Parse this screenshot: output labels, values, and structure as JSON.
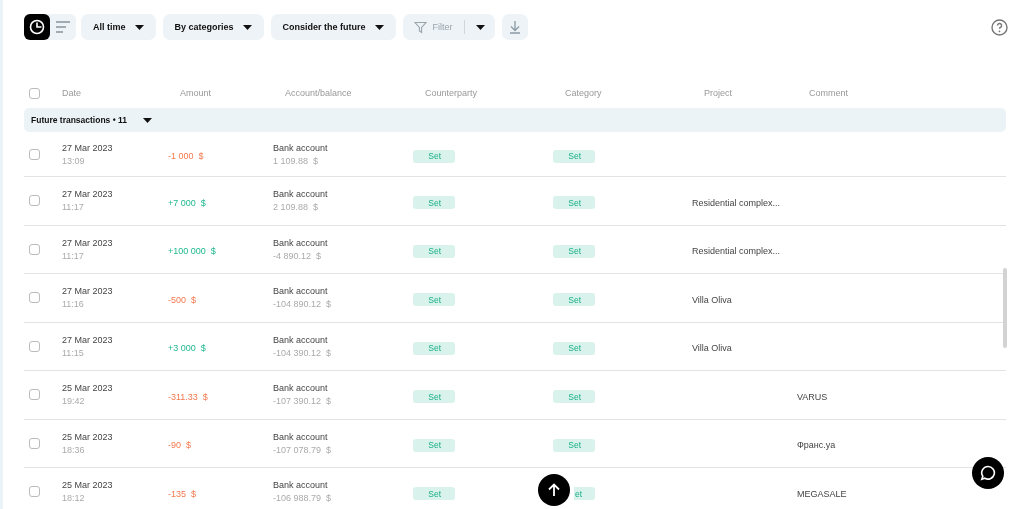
{
  "toolbar": {
    "views": [
      {
        "kind": "chart",
        "selected": true
      },
      {
        "kind": "list",
        "selected": false
      }
    ],
    "dropdowns": [
      {
        "label": "All time"
      },
      {
        "label": "By categories"
      },
      {
        "label": "Consider the future"
      }
    ],
    "filter": {
      "label": "Filter",
      "disabled": true
    }
  },
  "table": {
    "select_all": {
      "checked": false
    },
    "columns": [
      "Date",
      "Amount",
      "Account/balance",
      "Counterparty",
      "Category",
      "Project",
      "Comment"
    ],
    "group": {
      "label": "Future transactions • 11",
      "expanded": true
    },
    "rows": [
      {
        "checked": false,
        "date": "27 Mar 2023",
        "time": "13:09",
        "amount": "-1 000  $",
        "kind": "expense",
        "account": "Bank account",
        "balance": "1 109.88  $",
        "counterparty": "Set",
        "category": "Set"
      },
      {
        "checked": false,
        "date": "27 Mar 2023",
        "time": "11:17",
        "amount": "+7 000  $",
        "kind": "income",
        "account": "Bank account",
        "balance": "2 109.88  $",
        "counterparty": "Set",
        "category": "Set",
        "project": "Residential complex..."
      },
      {
        "checked": false,
        "date": "27 Mar 2023",
        "time": "11:17",
        "amount": "+100 000  $",
        "kind": "income",
        "account": "Bank account",
        "balance": "-4 890.12  $",
        "counterparty": "Set",
        "category": "Set",
        "project": "Residential complex..."
      },
      {
        "checked": false,
        "date": "27 Mar 2023",
        "time": "11:16",
        "amount": "-500  $",
        "kind": "expense",
        "account": "Bank account",
        "balance": "-104 890.12  $",
        "counterparty": "Set",
        "category": "Set",
        "project": "Villa Oliva"
      },
      {
        "checked": false,
        "date": "27 Mar 2023",
        "time": "11:15",
        "amount": "+3 000  $",
        "kind": "income",
        "account": "Bank account",
        "balance": "-104 390.12  $",
        "counterparty": "Set",
        "category": "Set",
        "project": "Villa Oliva"
      },
      {
        "checked": false,
        "date": "25 Mar 2023",
        "time": "19:42",
        "amount": "-311.33  $",
        "kind": "expense",
        "account": "Bank account",
        "balance": "-107 390.12  $",
        "counterparty": "Set",
        "category": "Set",
        "comment": "VARUS"
      },
      {
        "checked": false,
        "date": "25 Mar 2023",
        "time": "18:36",
        "amount": "-90  $",
        "kind": "expense",
        "account": "Bank account",
        "balance": "-107 078.79  $",
        "counterparty": "Set",
        "category": "Set",
        "comment": "Франс.уа"
      },
      {
        "checked": false,
        "date": "25 Mar 2023",
        "time": "18:12",
        "amount": "-135  $",
        "kind": "expense",
        "account": "Bank account",
        "balance": "-106 988.79  $",
        "counterparty": "Set",
        "category": "et",
        "comment": "MEGASALE"
      }
    ]
  }
}
